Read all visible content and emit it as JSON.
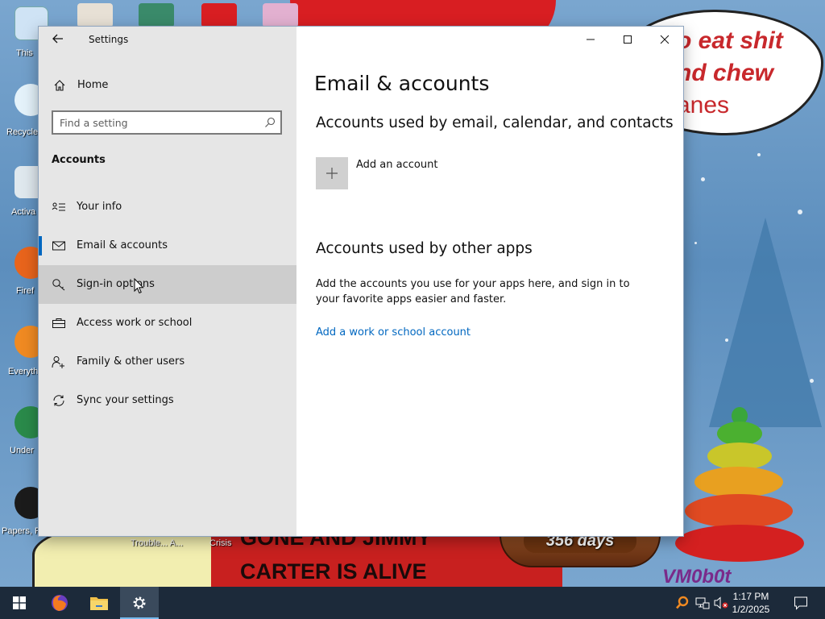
{
  "window": {
    "title": "Settings",
    "accent_color": "#0067c0",
    "link_color": "#0067c0"
  },
  "nav": {
    "home_label": "Home",
    "search_placeholder": "Find a setting",
    "section_label": "Accounts",
    "items": [
      {
        "label": "Your info",
        "icon": "contact-card-icon"
      },
      {
        "label": "Email & accounts",
        "icon": "mail-icon",
        "selected": true
      },
      {
        "label": "Sign-in options",
        "icon": "key-icon",
        "hovered": true
      },
      {
        "label": "Access work or school",
        "icon": "briefcase-icon"
      },
      {
        "label": "Family & other users",
        "icon": "person-add-icon"
      },
      {
        "label": "Sync your settings",
        "icon": "sync-icon"
      }
    ]
  },
  "content": {
    "page_title": "Email & accounts",
    "section1_title": "Accounts used by email, calendar, and contacts",
    "add_account_label": "Add an account",
    "section2_title": "Accounts used by other apps",
    "section2_desc": "Add the accounts you use for your apps here, and sign in to your favorite apps easier and faster.",
    "work_school_link": "Add a work or school account"
  },
  "desktop": {
    "speech_lines": [
      "o eat shit",
      "nd chew",
      "anes"
    ],
    "banner_lines": [
      "GONE AND JIMMY",
      "CARTER IS ALIVE"
    ],
    "globe_label": "356 days",
    "watermark": "VM0b0t",
    "icon_labels": [
      "This",
      "Recycle",
      "Activa",
      "Firef",
      "Everyth",
      "Under",
      "Papers, F"
    ],
    "bottom_labels": [
      "Trouble... A...",
      "Crisis"
    ]
  },
  "taskbar": {
    "time": "1:17 PM",
    "date": "1/2/2025"
  }
}
